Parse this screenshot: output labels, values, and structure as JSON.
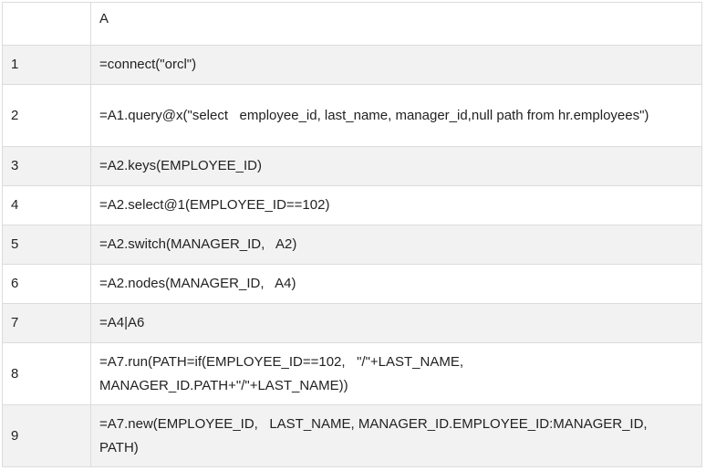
{
  "header": {
    "corner": "",
    "column": "A"
  },
  "rows": [
    {
      "num": "1",
      "cell": "=connect(\"orcl\")"
    },
    {
      "num": "2",
      "cell": "=A1.query@x(\"select   employee_id, last_name, manager_id,null path from hr.employees\")"
    },
    {
      "num": "3",
      "cell": "=A2.keys(EMPLOYEE_ID)"
    },
    {
      "num": "4",
      "cell": "=A2.select@1(EMPLOYEE_ID==102)"
    },
    {
      "num": "5",
      "cell": "=A2.switch(MANAGER_ID,   A2)"
    },
    {
      "num": "6",
      "cell": "=A2.nodes(MANAGER_ID,   A4)"
    },
    {
      "num": "7",
      "cell": "=A4|A6"
    },
    {
      "num": "8",
      "cell": "=A7.run(PATH=if(EMPLOYEE_ID==102,   \"/\"+LAST_NAME,\nMANAGER_ID.PATH+\"/\"+LAST_NAME))"
    },
    {
      "num": "9",
      "cell": "=A7.new(EMPLOYEE_ID,   LAST_NAME, MANAGER_ID.EMPLOYEE_ID:MANAGER_ID,\nPATH)"
    }
  ]
}
